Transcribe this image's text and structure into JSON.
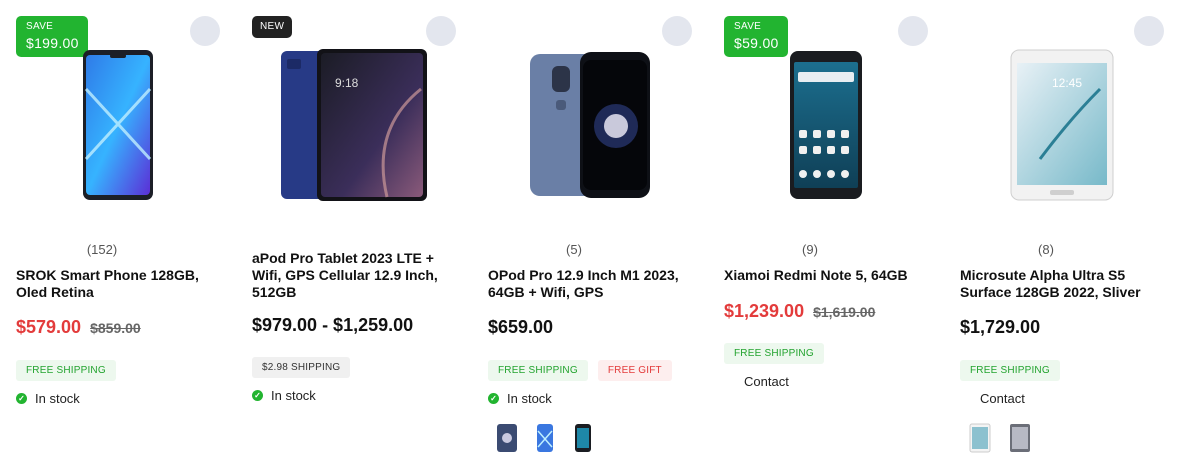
{
  "products": [
    {
      "badge": {
        "type": "save",
        "label": "SAVE",
        "amount": "$199.00"
      },
      "reviews": "(152)",
      "title": "SROK Smart Phone 128GB, Oled Retina",
      "price_sale": "$579.00",
      "price_old": "$859.00",
      "tags": [
        {
          "label": "FREE SHIPPING",
          "style": "green"
        }
      ],
      "stock": "In stock",
      "image_icon": "phone-blue-icon"
    },
    {
      "badge": {
        "type": "new",
        "label": "NEW"
      },
      "reviews": "",
      "title": "aPod Pro Tablet 2023 LTE + Wifi, GPS Cellular 12.9 Inch, 512GB",
      "price_range": "$979.00 - $1,259.00",
      "tags": [
        {
          "label": "$2.98 SHIPPING",
          "style": "grey"
        }
      ],
      "stock": "In stock",
      "image_icon": "tablet-navy-icon"
    },
    {
      "reviews": "(5)",
      "title": "OPod Pro 12.9 Inch M1 2023, 64GB + Wifi, GPS",
      "price": "$659.00",
      "tags": [
        {
          "label": "FREE SHIPPING",
          "style": "green"
        },
        {
          "label": "FREE GIFT",
          "style": "red"
        }
      ],
      "stock": "In stock",
      "swatches": [
        "phone-silver-swatch-icon",
        "phone-blue-swatch-icon",
        "phone-dark-swatch-icon"
      ],
      "image_icon": "phone-silver-icon"
    },
    {
      "badge": {
        "type": "save",
        "label": "SAVE",
        "amount": "$59.00"
      },
      "reviews": "(9)",
      "title": "Xiamoi Redmi Note 5, 64GB",
      "price_sale": "$1,239.00",
      "price_old": "$1,619.00",
      "tags": [
        {
          "label": "FREE SHIPPING",
          "style": "green"
        }
      ],
      "contact": "Contact",
      "image_icon": "phone-android-icon"
    },
    {
      "reviews": "(8)",
      "title": "Microsute Alpha Ultra S5 Surface 128GB 2022, Sliver",
      "price": "$1,729.00",
      "tags": [
        {
          "label": "FREE SHIPPING",
          "style": "green"
        }
      ],
      "contact": "Contact",
      "swatches": [
        "tablet-white-swatch-icon",
        "tablet-grey-swatch-icon"
      ],
      "image_icon": "tablet-white-icon"
    }
  ]
}
